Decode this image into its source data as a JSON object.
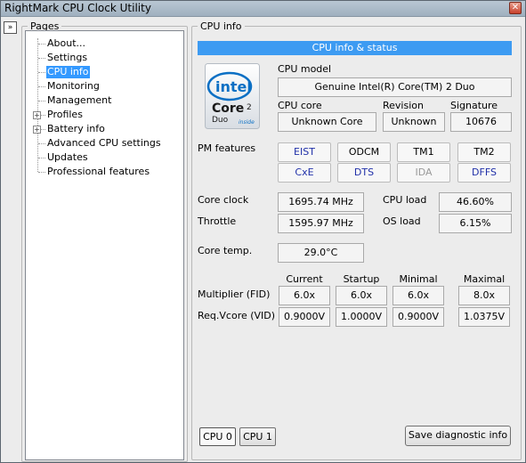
{
  "window": {
    "title": "RightMark CPU Clock Utility",
    "close_glyph": "✕"
  },
  "collapse_glyph": "»",
  "pages": {
    "legend": "Pages",
    "items": [
      {
        "label": "About...",
        "expandable": false,
        "selected": false
      },
      {
        "label": "Settings",
        "expandable": false,
        "selected": false
      },
      {
        "label": "CPU info",
        "expandable": false,
        "selected": true
      },
      {
        "label": "Monitoring",
        "expandable": false,
        "selected": false
      },
      {
        "label": "Management",
        "expandable": false,
        "selected": false
      },
      {
        "label": "Profiles",
        "expandable": true,
        "selected": false
      },
      {
        "label": "Battery info",
        "expandable": true,
        "selected": false
      },
      {
        "label": "Advanced CPU settings",
        "expandable": false,
        "selected": false
      },
      {
        "label": "Updates",
        "expandable": false,
        "selected": false
      },
      {
        "label": "Professional features",
        "expandable": false,
        "selected": false
      }
    ],
    "expander_glyph": "+"
  },
  "cpuinfo": {
    "legend": "CPU info",
    "header": "CPU info & status",
    "logo": {
      "brand": "intel",
      "product": "Core",
      "superscript": "2",
      "sub": "Duo",
      "tag": "inside"
    },
    "model_label": "CPU model",
    "model_value": "Genuine Intel(R) Core(TM) 2 Duo",
    "core_label": "CPU core",
    "core_value": "Unknown Core",
    "revision_label": "Revision",
    "revision_value": "Unknown",
    "signature_label": "Signature",
    "signature_value": "10676",
    "pm_label": "PM features",
    "features": [
      {
        "name": "EIST",
        "state": "active"
      },
      {
        "name": "ODCM",
        "state": "normal"
      },
      {
        "name": "TM1",
        "state": "normal"
      },
      {
        "name": "TM2",
        "state": "normal"
      },
      {
        "name": "CxE",
        "state": "active"
      },
      {
        "name": "DTS",
        "state": "active"
      },
      {
        "name": "IDA",
        "state": "disabled"
      },
      {
        "name": "DFFS",
        "state": "active"
      }
    ],
    "core_clock_label": "Core clock",
    "core_clock_value": "1695.74 MHz",
    "cpu_load_label": "CPU load",
    "cpu_load_value": "46.60%",
    "throttle_label": "Throttle",
    "throttle_value": "1595.97 MHz",
    "os_load_label": "OS load",
    "os_load_value": "6.15%",
    "core_temp_label": "Core temp.",
    "core_temp_value": "29.0°C",
    "table": {
      "columns": [
        "Current",
        "Startup",
        "Minimal",
        "Maximal"
      ],
      "rows": [
        {
          "label": "Multiplier (FID)",
          "values": [
            "6.0x",
            "6.0x",
            "6.0x",
            "8.0x"
          ]
        },
        {
          "label": "Req.Vcore (VID)",
          "values": [
            "0.9000V",
            "1.0000V",
            "0.9000V",
            "1.0375V"
          ]
        }
      ]
    },
    "cpu_tabs": [
      {
        "label": "CPU 0",
        "active": true
      },
      {
        "label": "CPU 1",
        "active": false
      }
    ],
    "save_button": "Save diagnostic info"
  },
  "colors": {
    "accent": "#3d9bf2",
    "feature_active": "#1f2fa8",
    "feature_disabled": "#9a9a9a",
    "feature_normal": "#000000"
  }
}
